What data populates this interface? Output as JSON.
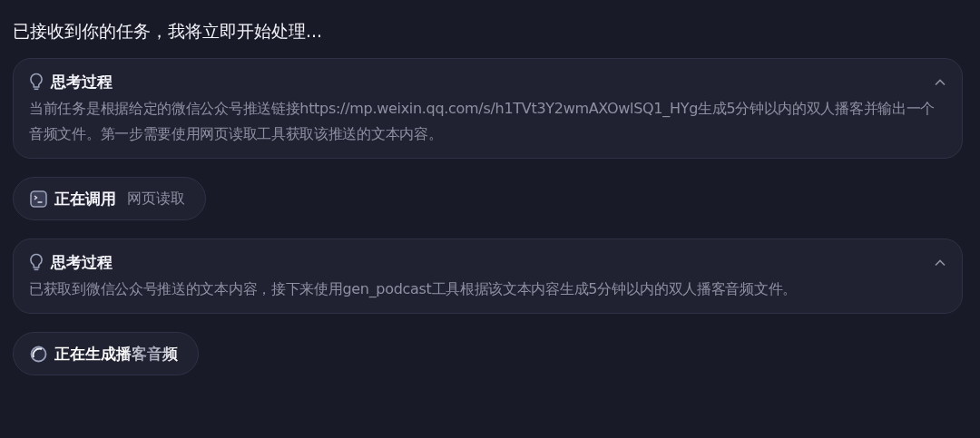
{
  "message": "已接收到你的任务，我将立即开始处理...",
  "steps": [
    {
      "kind": "thought",
      "title": "思考过程",
      "expanded": true,
      "body": "当前任务是根据给定的微信公众号推送链接https://mp.weixin.qq.com/s/h1TVt3Y2wmAXOwlSQ1_HYg生成5分钟以内的双人播客并输出一个音频文件。第一步需要使用网页读取工具获取该推送的文本内容。"
    },
    {
      "kind": "tool",
      "label": "正在调用",
      "detail": "网页读取"
    },
    {
      "kind": "thought",
      "title": "思考过程",
      "expanded": true,
      "body": "已获取到微信公众号推送的文本内容，接下来使用gen_podcast工具根据该文本内容生成5分钟以内的双人播客音频文件。"
    },
    {
      "kind": "progress",
      "label": "正在生成播客音频"
    }
  ]
}
